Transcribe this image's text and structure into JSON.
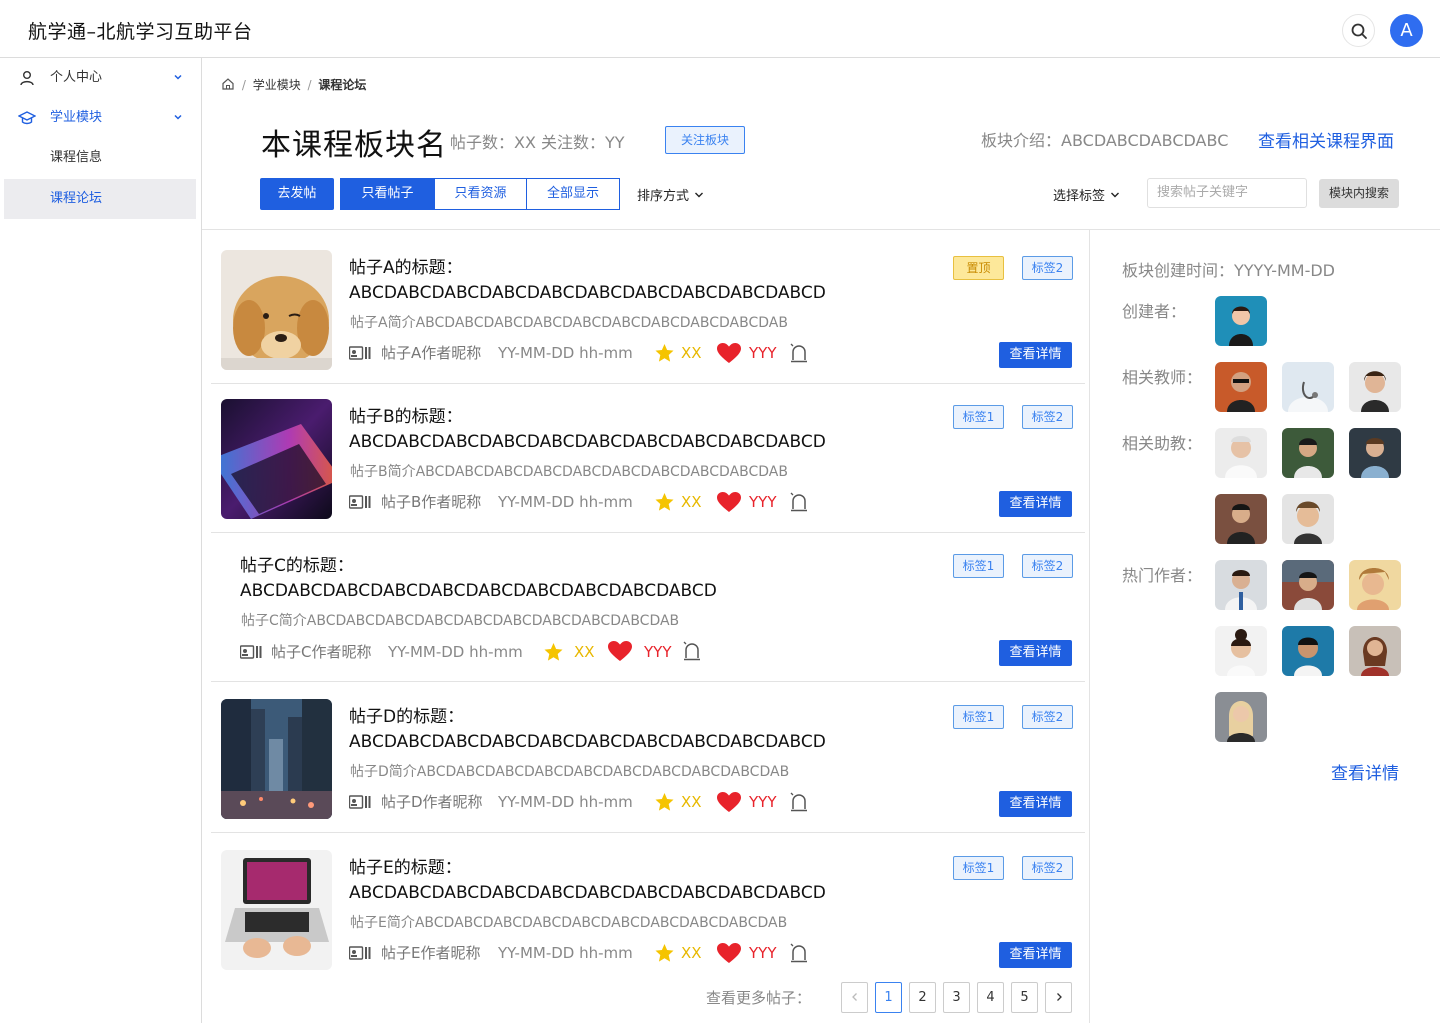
{
  "header": {
    "app_title": "航学通–北航学习互助平台",
    "avatar_letter": "A"
  },
  "sidebar": {
    "items": [
      {
        "label": "个人中心"
      },
      {
        "label": "学业模块"
      },
      {
        "label": "课程信息"
      },
      {
        "label": "课程论坛"
      }
    ]
  },
  "breadcrumb": {
    "sep1": "/",
    "level1": "学业模块",
    "sep2": "/",
    "level2": "课程论坛"
  },
  "board": {
    "title": "本课程板块名",
    "stats": "帖子数：XX 关注数：YY",
    "follow_label": "关注板块",
    "intro": "板块介绍：ABCDABCDABCDABC",
    "related_link": "查看相关课程界面"
  },
  "toolbar": {
    "post_label": "去发帖",
    "filters": [
      "只看帖子",
      "只看资源",
      "全部显示"
    ],
    "sort_label": "排序方式",
    "tag_select_label": "选择标签",
    "search_placeholder": "搜索帖子关键字",
    "search_button": "模块内搜索"
  },
  "posts": [
    {
      "title_line1": "帖子A的标题：",
      "title_line2": "ABCDABCDABCDABCDABCDABCDABCDABCDABCDABCD",
      "summary": "帖子A简介ABCDABCDABCDABCDABCDABCDABCDABCDABCDAB",
      "author": "帖子A作者昵称",
      "time": "YY-MM-DD hh-mm",
      "stars": "XX",
      "likes": "YYY",
      "tags": [
        "置顶",
        "标签2"
      ],
      "detail": "查看详情"
    },
    {
      "title_line1": "帖子B的标题：",
      "title_line2": "ABCDABCDABCDABCDABCDABCDABCDABCDABCDABCD",
      "summary": "帖子B简介ABCDABCDABCDABCDABCDABCDABCDABCDABCDAB",
      "author": "帖子B作者昵称",
      "time": "YY-MM-DD hh-mm",
      "stars": "XX",
      "likes": "YYY",
      "tags": [
        "标签1",
        "标签2"
      ],
      "detail": "查看详情"
    },
    {
      "title_line1": "帖子C的标题：",
      "title_line2": "ABCDABCDABCDABCDABCDABCDABCDABCDABCDABCD",
      "summary": "帖子C简介ABCDABCDABCDABCDABCDABCDABCDABCDABCDAB",
      "author": "帖子C作者昵称",
      "time": "YY-MM-DD hh-mm",
      "stars": "XX",
      "likes": "YYY",
      "tags": [
        "标签1",
        "标签2"
      ],
      "detail": "查看详情"
    },
    {
      "title_line1": "帖子D的标题：",
      "title_line2": "ABCDABCDABCDABCDABCDABCDABCDABCDABCDABCD",
      "summary": "帖子D简介ABCDABCDABCDABCDABCDABCDABCDABCDABCDAB",
      "author": "帖子D作者昵称",
      "time": "YY-MM-DD hh-mm",
      "stars": "XX",
      "likes": "YYY",
      "tags": [
        "标签1",
        "标签2"
      ],
      "detail": "查看详情"
    },
    {
      "title_line1": "帖子E的标题：",
      "title_line2": "ABCDABCDABCDABCDABCDABCDABCDABCDABCDABCD",
      "summary": "帖子E简介ABCDABCDABCDABCDABCDABCDABCDABCDABCDAB",
      "author": "帖子E作者昵称",
      "time": "YY-MM-DD hh-mm",
      "stars": "XX",
      "likes": "YYY",
      "tags": [
        "标签1",
        "标签2"
      ],
      "detail": "查看详情"
    }
  ],
  "pagination": {
    "label": "查看更多帖子：",
    "pages": [
      "1",
      "2",
      "3",
      "4",
      "5"
    ],
    "current": "1"
  },
  "right_panel": {
    "created": "板块创建时间：YYYY-MM-DD",
    "creator_label": "创建者：",
    "teachers_label": "相关教师：",
    "tas_label": "相关助教：",
    "hot_authors_label": "热门作者：",
    "detail_link": "查看详情"
  },
  "colors": {
    "accent": "#1f5fe0",
    "star": "#f5c400",
    "heart": "#e8232b",
    "pin_tag": "#fde89a"
  }
}
